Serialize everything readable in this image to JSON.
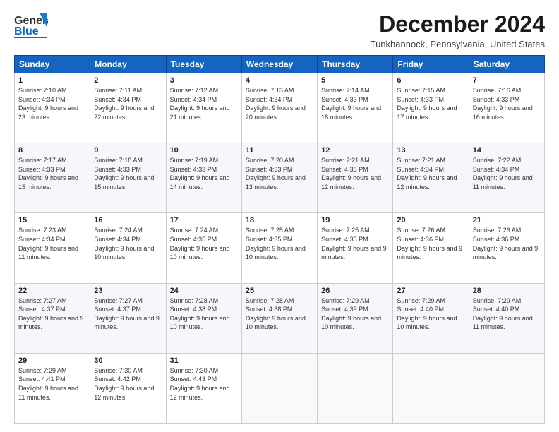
{
  "header": {
    "logo_general": "General",
    "logo_blue": "Blue",
    "month_title": "December 2024",
    "location": "Tunkhannock, Pennsylvania, United States"
  },
  "days_of_week": [
    "Sunday",
    "Monday",
    "Tuesday",
    "Wednesday",
    "Thursday",
    "Friday",
    "Saturday"
  ],
  "weeks": [
    [
      {
        "day": "1",
        "rise": "Sunrise: 7:10 AM",
        "set": "Sunset: 4:34 PM",
        "daylight": "Daylight: 9 hours and 23 minutes."
      },
      {
        "day": "2",
        "rise": "Sunrise: 7:11 AM",
        "set": "Sunset: 4:34 PM",
        "daylight": "Daylight: 9 hours and 22 minutes."
      },
      {
        "day": "3",
        "rise": "Sunrise: 7:12 AM",
        "set": "Sunset: 4:34 PM",
        "daylight": "Daylight: 9 hours and 21 minutes."
      },
      {
        "day": "4",
        "rise": "Sunrise: 7:13 AM",
        "set": "Sunset: 4:34 PM",
        "daylight": "Daylight: 9 hours and 20 minutes."
      },
      {
        "day": "5",
        "rise": "Sunrise: 7:14 AM",
        "set": "Sunset: 4:33 PM",
        "daylight": "Daylight: 9 hours and 18 minutes."
      },
      {
        "day": "6",
        "rise": "Sunrise: 7:15 AM",
        "set": "Sunset: 4:33 PM",
        "daylight": "Daylight: 9 hours and 17 minutes."
      },
      {
        "day": "7",
        "rise": "Sunrise: 7:16 AM",
        "set": "Sunset: 4:33 PM",
        "daylight": "Daylight: 9 hours and 16 minutes."
      }
    ],
    [
      {
        "day": "8",
        "rise": "Sunrise: 7:17 AM",
        "set": "Sunset: 4:33 PM",
        "daylight": "Daylight: 9 hours and 15 minutes."
      },
      {
        "day": "9",
        "rise": "Sunrise: 7:18 AM",
        "set": "Sunset: 4:33 PM",
        "daylight": "Daylight: 9 hours and 15 minutes."
      },
      {
        "day": "10",
        "rise": "Sunrise: 7:19 AM",
        "set": "Sunset: 4:33 PM",
        "daylight": "Daylight: 9 hours and 14 minutes."
      },
      {
        "day": "11",
        "rise": "Sunrise: 7:20 AM",
        "set": "Sunset: 4:33 PM",
        "daylight": "Daylight: 9 hours and 13 minutes."
      },
      {
        "day": "12",
        "rise": "Sunrise: 7:21 AM",
        "set": "Sunset: 4:33 PM",
        "daylight": "Daylight: 9 hours and 12 minutes."
      },
      {
        "day": "13",
        "rise": "Sunrise: 7:21 AM",
        "set": "Sunset: 4:34 PM",
        "daylight": "Daylight: 9 hours and 12 minutes."
      },
      {
        "day": "14",
        "rise": "Sunrise: 7:22 AM",
        "set": "Sunset: 4:34 PM",
        "daylight": "Daylight: 9 hours and 11 minutes."
      }
    ],
    [
      {
        "day": "15",
        "rise": "Sunrise: 7:23 AM",
        "set": "Sunset: 4:34 PM",
        "daylight": "Daylight: 9 hours and 11 minutes."
      },
      {
        "day": "16",
        "rise": "Sunrise: 7:24 AM",
        "set": "Sunset: 4:34 PM",
        "daylight": "Daylight: 9 hours and 10 minutes."
      },
      {
        "day": "17",
        "rise": "Sunrise: 7:24 AM",
        "set": "Sunset: 4:35 PM",
        "daylight": "Daylight: 9 hours and 10 minutes."
      },
      {
        "day": "18",
        "rise": "Sunrise: 7:25 AM",
        "set": "Sunset: 4:35 PM",
        "daylight": "Daylight: 9 hours and 10 minutes."
      },
      {
        "day": "19",
        "rise": "Sunrise: 7:25 AM",
        "set": "Sunset: 4:35 PM",
        "daylight": "Daylight: 9 hours and 9 minutes."
      },
      {
        "day": "20",
        "rise": "Sunrise: 7:26 AM",
        "set": "Sunset: 4:36 PM",
        "daylight": "Daylight: 9 hours and 9 minutes."
      },
      {
        "day": "21",
        "rise": "Sunrise: 7:26 AM",
        "set": "Sunset: 4:36 PM",
        "daylight": "Daylight: 9 hours and 9 minutes."
      }
    ],
    [
      {
        "day": "22",
        "rise": "Sunrise: 7:27 AM",
        "set": "Sunset: 4:37 PM",
        "daylight": "Daylight: 9 hours and 9 minutes."
      },
      {
        "day": "23",
        "rise": "Sunrise: 7:27 AM",
        "set": "Sunset: 4:37 PM",
        "daylight": "Daylight: 9 hours and 9 minutes."
      },
      {
        "day": "24",
        "rise": "Sunrise: 7:28 AM",
        "set": "Sunset: 4:38 PM",
        "daylight": "Daylight: 9 hours and 10 minutes."
      },
      {
        "day": "25",
        "rise": "Sunrise: 7:28 AM",
        "set": "Sunset: 4:38 PM",
        "daylight": "Daylight: 9 hours and 10 minutes."
      },
      {
        "day": "26",
        "rise": "Sunrise: 7:29 AM",
        "set": "Sunset: 4:39 PM",
        "daylight": "Daylight: 9 hours and 10 minutes."
      },
      {
        "day": "27",
        "rise": "Sunrise: 7:29 AM",
        "set": "Sunset: 4:40 PM",
        "daylight": "Daylight: 9 hours and 10 minutes."
      },
      {
        "day": "28",
        "rise": "Sunrise: 7:29 AM",
        "set": "Sunset: 4:40 PM",
        "daylight": "Daylight: 9 hours and 11 minutes."
      }
    ],
    [
      {
        "day": "29",
        "rise": "Sunrise: 7:29 AM",
        "set": "Sunset: 4:41 PM",
        "daylight": "Daylight: 9 hours and 11 minutes."
      },
      {
        "day": "30",
        "rise": "Sunrise: 7:30 AM",
        "set": "Sunset: 4:42 PM",
        "daylight": "Daylight: 9 hours and 12 minutes."
      },
      {
        "day": "31",
        "rise": "Sunrise: 7:30 AM",
        "set": "Sunset: 4:43 PM",
        "daylight": "Daylight: 9 hours and 12 minutes."
      },
      null,
      null,
      null,
      null
    ]
  ]
}
